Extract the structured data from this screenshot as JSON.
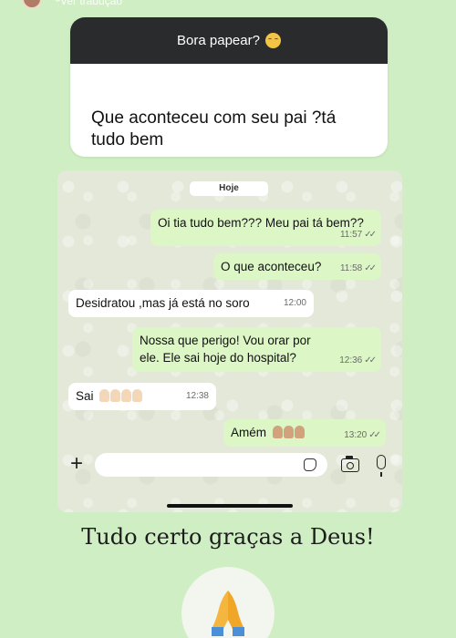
{
  "top": {
    "translate_link": "Ver tradução"
  },
  "question_sticker": {
    "title": "Bora papear?",
    "title_emoji": "relieved-face-emoji",
    "answer": "Que aconteceu com seu pai ?tá tudo bem"
  },
  "chat": {
    "day_label": "Hoje",
    "messages": [
      {
        "direction": "outgoing",
        "text": "Oi tia tudo bem??? Meu pai tá bem??",
        "time": "11:57",
        "status": "read"
      },
      {
        "direction": "outgoing",
        "text": "O que aconteceu?",
        "time": "11:58",
        "status": "read"
      },
      {
        "direction": "incoming",
        "text": "Desidratou ,mas já está no soro",
        "time": "12:00"
      },
      {
        "direction": "outgoing",
        "text": "Nossa que perigo! Vou orar por ele. Ele sai hoje do hospital?",
        "time": "12:36",
        "status": "read"
      },
      {
        "direction": "incoming",
        "text": "Sai",
        "emoji": "raising-hands-emoji x4",
        "time": "12:38"
      },
      {
        "direction": "outgoing",
        "text": "Amém",
        "emoji": "folded-hands-emoji x3",
        "time": "13:20",
        "status": "read"
      }
    ],
    "composer": {
      "input_value": "",
      "icons": [
        "plus-icon",
        "sticker-icon",
        "camera-icon",
        "microphone-icon"
      ]
    }
  },
  "caption": "Tudo certo graças a Deus!",
  "bottom_sticker": "folded-hands-emoji",
  "colors": {
    "story_background": "#cfeec4",
    "question_header": "#2a2b2d",
    "outgoing_bubble": "#dcf6c6",
    "incoming_bubble": "#ffffff"
  }
}
